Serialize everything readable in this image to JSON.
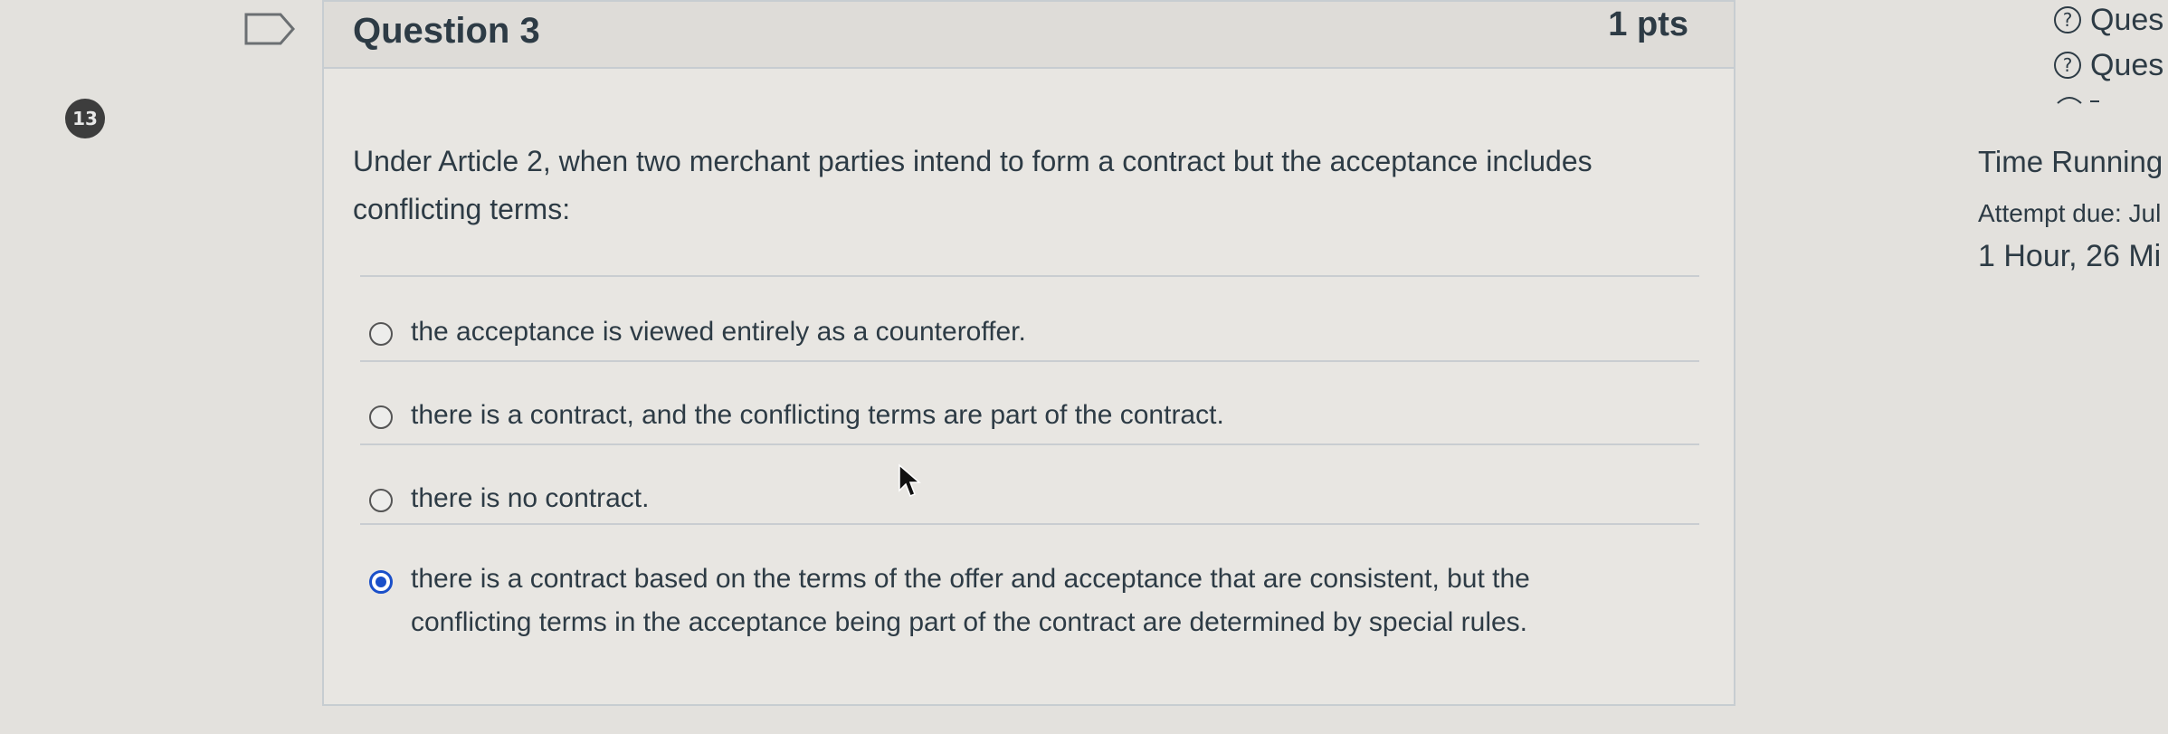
{
  "question": {
    "number_badge": "13",
    "title": "Question 3",
    "points": "1 pts",
    "text": "Under Article 2, when two merchant parties intend to form a contract but the acceptance includes conflicting terms:",
    "answers": [
      {
        "text": "the acceptance is viewed entirely as a counteroffer.",
        "selected": false
      },
      {
        "text": "there is a contract, and the conflicting terms are part of the contract.",
        "selected": false
      },
      {
        "text": "there is no contract.",
        "selected": false
      },
      {
        "text": "there is a contract based on the terms of the offer and acceptance that are consistent, but the conflicting terms in the acceptance being part of the contract are determined by special rules.",
        "selected": true
      }
    ]
  },
  "sidebar": {
    "links": [
      "Ques",
      "Ques"
    ],
    "help_glyph": "?",
    "timer_title": "Time Running",
    "attempt_due": "Attempt due: Jul",
    "time_left": "1 Hour, 26 Mi"
  },
  "colors": {
    "selected_radio": "#1a4fc9",
    "background": "#e3e1dd",
    "text": "#2d3b45"
  },
  "icons": [
    "bookmark-flag-icon",
    "help-icon",
    "mouse-cursor-icon"
  ]
}
